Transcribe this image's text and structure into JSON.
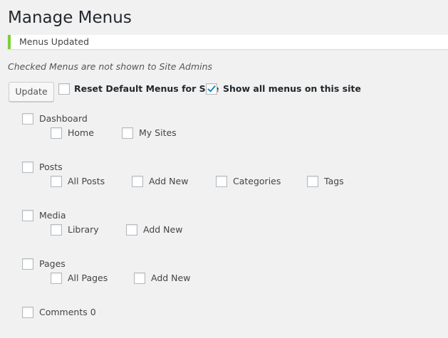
{
  "page_title": "Manage Menus",
  "notice": {
    "text": "Menus Updated",
    "accent_color": "#7ad03a"
  },
  "hint": "Checked Menus are not shown to Site Admins",
  "toolbar": {
    "update_label": "Update",
    "reset_label": "Reset Default Menus for Site",
    "reset_checked": false,
    "show_all_label": "Show all menus on this site",
    "show_all_checked": true
  },
  "menus": [
    {
      "label": "Dashboard",
      "checked": false,
      "children": [
        {
          "label": "Home",
          "checked": false
        },
        {
          "label": "My Sites",
          "checked": false
        }
      ]
    },
    {
      "label": "Posts",
      "checked": false,
      "children": [
        {
          "label": "All Posts",
          "checked": false
        },
        {
          "label": "Add New",
          "checked": false
        },
        {
          "label": "Categories",
          "checked": false
        },
        {
          "label": "Tags",
          "checked": false
        }
      ]
    },
    {
      "label": "Media",
      "checked": false,
      "children": [
        {
          "label": "Library",
          "checked": false
        },
        {
          "label": "Add New",
          "checked": false
        }
      ]
    },
    {
      "label": "Pages",
      "checked": false,
      "children": [
        {
          "label": "All Pages",
          "checked": false
        },
        {
          "label": "Add New",
          "checked": false
        }
      ]
    },
    {
      "label": "Comments 0",
      "checked": false,
      "children": []
    }
  ]
}
